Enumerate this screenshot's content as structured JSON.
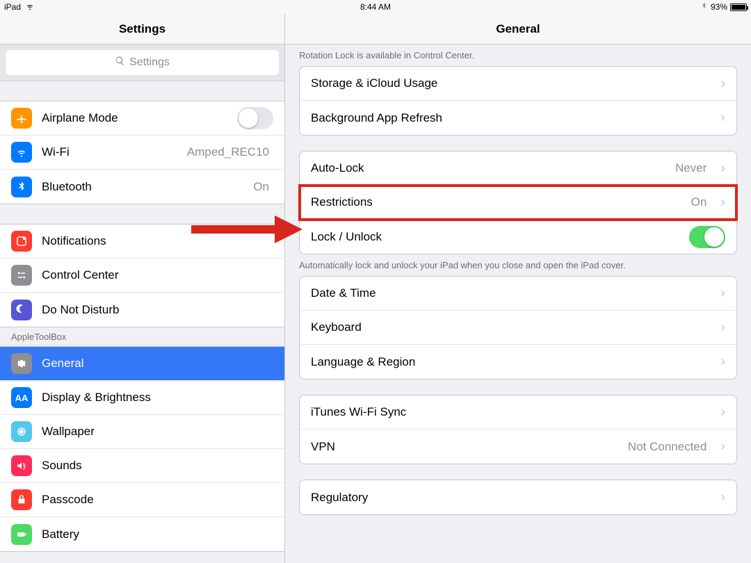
{
  "status": {
    "device": "iPad",
    "time": "8:44 AM",
    "battery_pct": "93%"
  },
  "sidebar": {
    "title": "Settings",
    "search_placeholder": "Settings",
    "groups": [
      {
        "items": [
          {
            "name": "airplane",
            "label": "Airplane Mode",
            "icon_bg": "#ff9500",
            "control": "toggle_off"
          },
          {
            "name": "wifi",
            "label": "Wi-Fi",
            "icon_bg": "#007aff",
            "value": "Amped_REC10"
          },
          {
            "name": "bluetooth",
            "label": "Bluetooth",
            "icon_bg": "#007aff",
            "value": "On"
          }
        ]
      },
      {
        "items": [
          {
            "name": "notifications",
            "label": "Notifications",
            "icon_bg": "#ff3b30"
          },
          {
            "name": "controlcenter",
            "label": "Control Center",
            "icon_bg": "#8e8e93"
          },
          {
            "name": "dnd",
            "label": "Do Not Disturb",
            "icon_bg": "#5856d6"
          }
        ]
      }
    ],
    "section2_header": "AppleToolBox",
    "group2_items": [
      {
        "name": "general",
        "label": "General",
        "icon_bg": "#8e8e93",
        "selected": true
      },
      {
        "name": "display",
        "label": "Display & Brightness",
        "icon_bg": "#007aff"
      },
      {
        "name": "wallpaper",
        "label": "Wallpaper",
        "icon_bg": "#54c7ec"
      },
      {
        "name": "sounds",
        "label": "Sounds",
        "icon_bg": "#ff2d55"
      },
      {
        "name": "passcode",
        "label": "Passcode",
        "icon_bg": "#ff3b30"
      },
      {
        "name": "battery",
        "label": "Battery",
        "icon_bg": "#4cd964"
      }
    ]
  },
  "detail": {
    "title": "General",
    "note_rotation": "Rotation Lock is available in Control Center.",
    "group_storage": [
      {
        "name": "storage",
        "label": "Storage & iCloud Usage"
      },
      {
        "name": "bgrefresh",
        "label": "Background App Refresh"
      }
    ],
    "group_lock": [
      {
        "name": "autolock",
        "label": "Auto-Lock",
        "value": "Never"
      },
      {
        "name": "restrictions",
        "label": "Restrictions",
        "value": "On",
        "highlight": true
      },
      {
        "name": "lockunlock",
        "label": "Lock / Unlock",
        "control": "toggle_on"
      }
    ],
    "note_lockunlock": "Automatically lock and unlock your iPad when you close and open the iPad cover.",
    "group_locale": [
      {
        "name": "datetime",
        "label": "Date & Time"
      },
      {
        "name": "keyboard",
        "label": "Keyboard"
      },
      {
        "name": "language",
        "label": "Language & Region"
      }
    ],
    "group_sync": [
      {
        "name": "ituneswifi",
        "label": "iTunes Wi-Fi Sync"
      },
      {
        "name": "vpn",
        "label": "VPN",
        "value": "Not Connected"
      }
    ],
    "group_reg": [
      {
        "name": "regulatory",
        "label": "Regulatory"
      }
    ]
  }
}
